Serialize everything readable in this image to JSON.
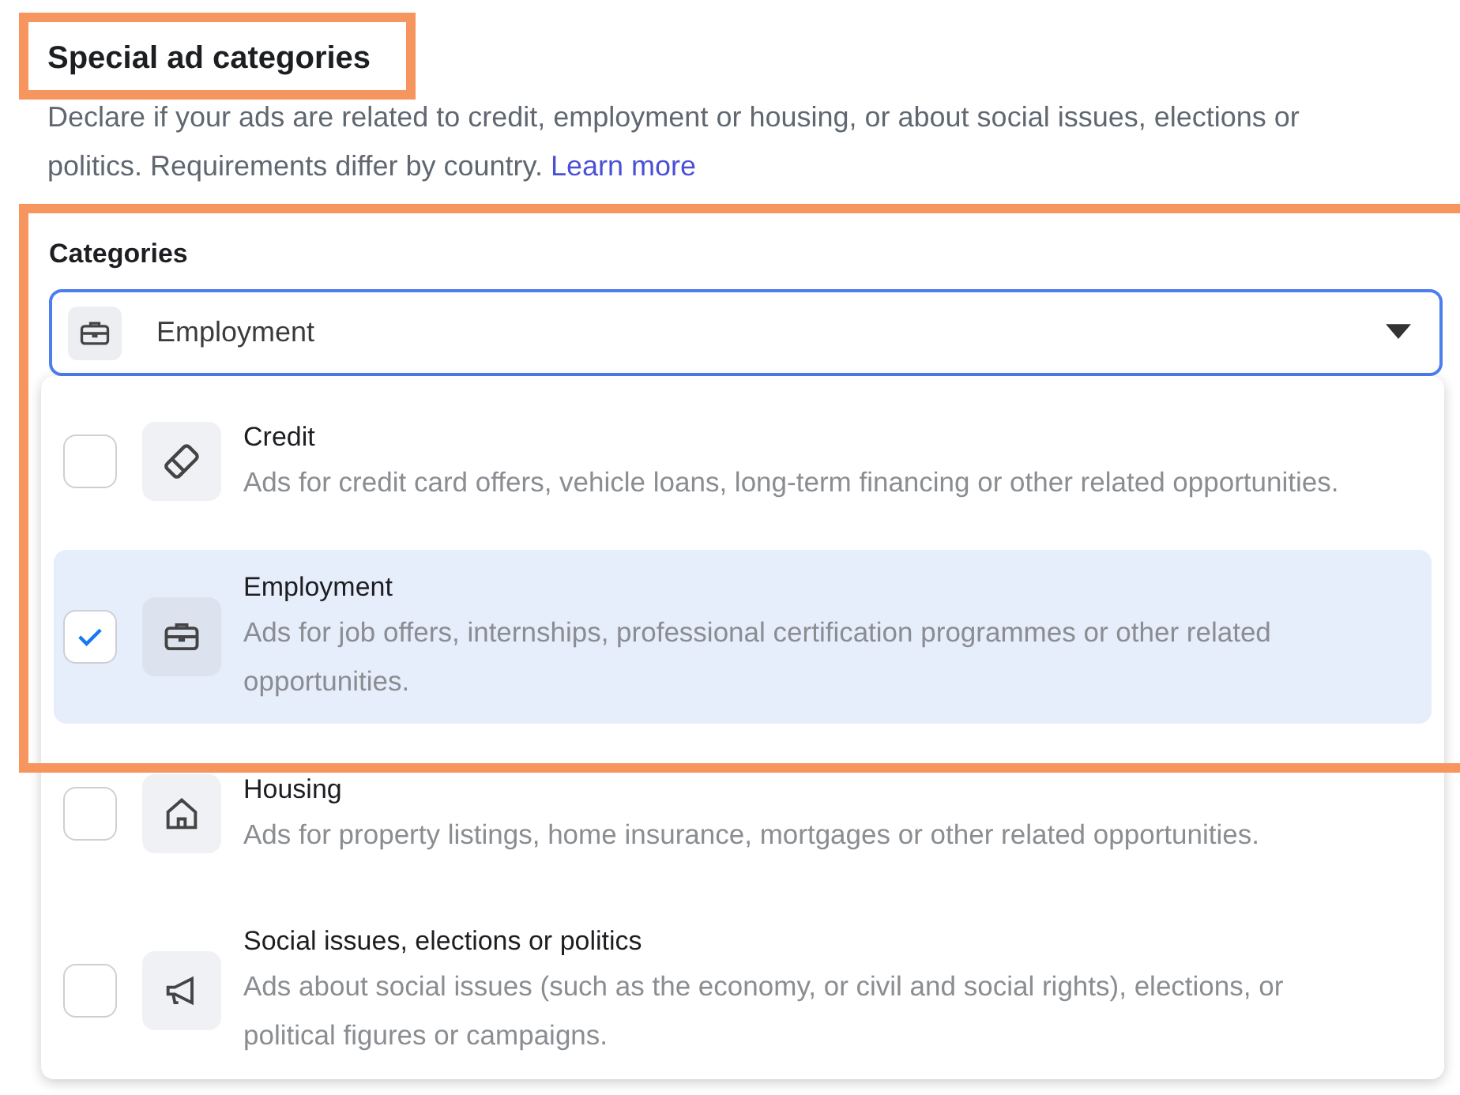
{
  "heading": {
    "text": "Special ad categories",
    "highlighted": true
  },
  "description": {
    "text": "Declare if your ads are related to credit, employment or housing, or about social issues, elections or politics. Requirements differ by country.",
    "link": "Learn more"
  },
  "categories": {
    "label": "Categories",
    "highlighted": true,
    "select": {
      "value": "Employment"
    },
    "options": [
      {
        "kind": "credit",
        "title": "Credit",
        "description": "Ads for credit card offers, vehicle loans, long-term financing or other related opportunities.",
        "checked": false
      },
      {
        "kind": "employment",
        "title": "Employment",
        "description": "Ads for job offers, internships, professional certification programmes or other related opportunities.",
        "checked": true
      },
      {
        "kind": "housing",
        "title": "Housing",
        "description": "Ads for property listings, home insurance, mortgages or other related opportunities.",
        "checked": false
      },
      {
        "kind": "social",
        "title": "Social issues, elections or politics",
        "description": "Ads about social issues (such as the economy, or civil and social rights), elections, or political figures or campaigns.",
        "checked": false
      }
    ]
  }
}
